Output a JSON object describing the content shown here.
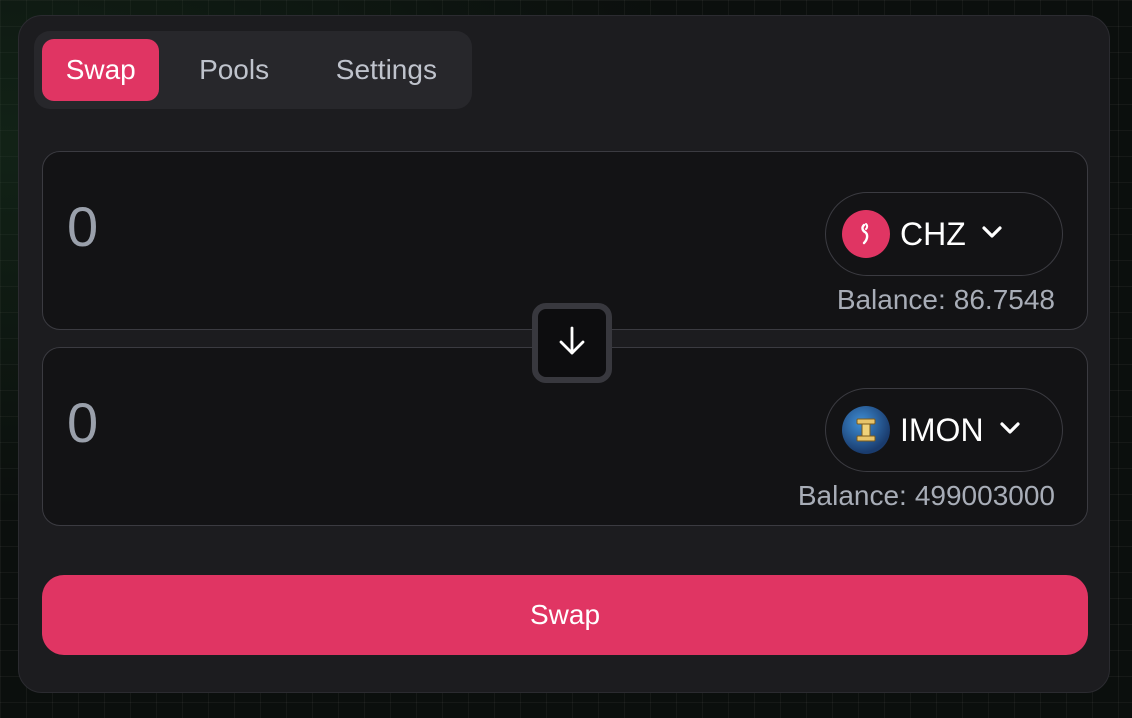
{
  "tabs": {
    "swap": "Swap",
    "pools": "Pools",
    "settings": "Settings",
    "active": "Swap"
  },
  "from": {
    "amount": "0",
    "token": {
      "symbol": "CHZ",
      "icon": "chiliz-logo-icon"
    },
    "balance_label": "Balance:",
    "balance_value": "86.7548"
  },
  "to": {
    "amount": "0",
    "token": {
      "symbol": "IMON",
      "icon": "imon-logo-icon"
    },
    "balance_label": "Balance:",
    "balance_value": "499003000"
  },
  "switch_icon": "arrow-down-icon",
  "action": {
    "swap_label": "Swap"
  },
  "colors": {
    "accent": "#e03563",
    "card_background": "#1c1c1f",
    "panel_background": "#131315",
    "border": "#3b3b41",
    "muted_text": "#a8adb7"
  }
}
